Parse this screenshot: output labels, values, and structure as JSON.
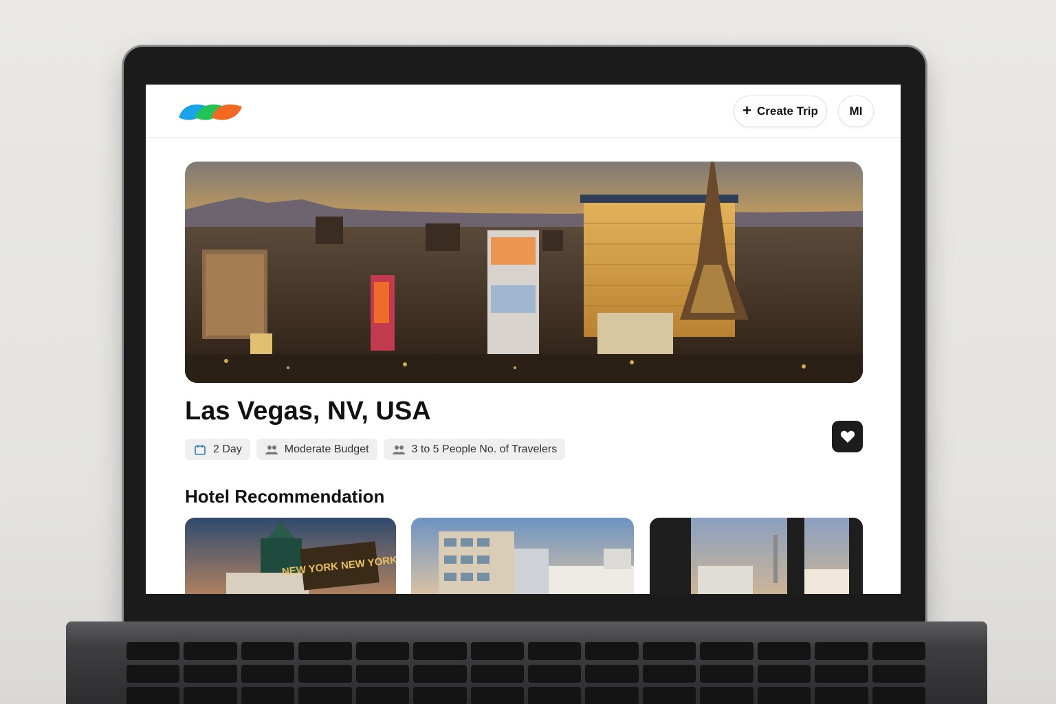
{
  "app": {
    "logo_icon": "tri-leaf-logo",
    "create_trip_label": "Create Trip",
    "create_trip_icon": "plus-icon",
    "avatar_initials": "MI"
  },
  "trip": {
    "destination": "Las Vegas, NV, USA",
    "chips": [
      {
        "icon": "calendar-icon",
        "label": "2 Day"
      },
      {
        "icon": "people-icon",
        "label": "Moderate Budget"
      },
      {
        "icon": "people-icon",
        "label": "3 to 5 People No. of Travelers"
      }
    ],
    "favorite_icon": "heart-icon"
  },
  "sections": {
    "hotels_title": "Hotel Recommendation"
  },
  "hotels": [
    {
      "image_sign": "NEW YORK NEW YORK"
    },
    {
      "image_sign": ""
    },
    {
      "image_sign": ""
    }
  ],
  "colors": {
    "logo_blue": "#1aa3e8",
    "logo_green": "#23c35a",
    "logo_orange": "#f26a21"
  }
}
